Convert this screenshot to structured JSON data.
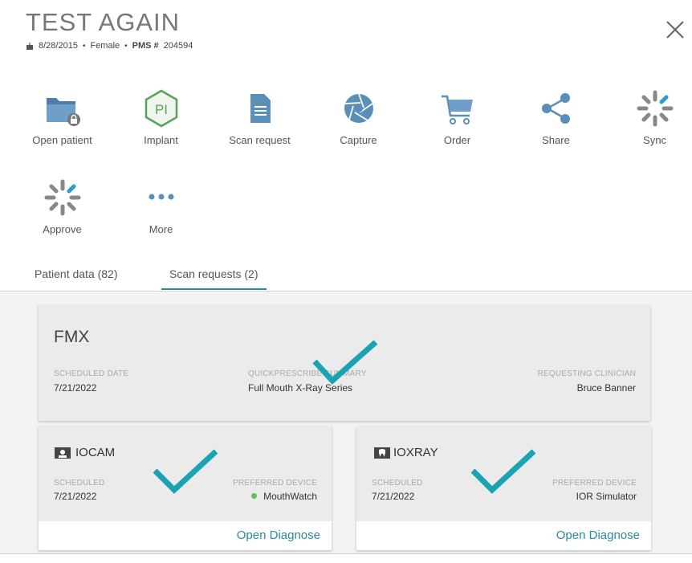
{
  "patient": {
    "name": "TEST AGAIN",
    "dob": "8/28/2015",
    "sex": "Female",
    "pms_label": "PMS #",
    "pms_number": "204594"
  },
  "actions": [
    {
      "label": "Open patient",
      "icon": "folder-lock-icon"
    },
    {
      "label": "Implant",
      "icon": "implant-icon"
    },
    {
      "label": "Scan request",
      "icon": "document-icon"
    },
    {
      "label": "Capture",
      "icon": "aperture-icon"
    },
    {
      "label": "Order",
      "icon": "cart-icon"
    },
    {
      "label": "Share",
      "icon": "share-icon"
    },
    {
      "label": "Sync",
      "icon": "spinner-icon"
    },
    {
      "label": "Approve",
      "icon": "spinner-icon"
    },
    {
      "label": "More",
      "icon": "more-dots-icon"
    }
  ],
  "tabs": [
    {
      "label": "Patient data (82)",
      "active": false
    },
    {
      "label": "Scan requests (2)",
      "active": true
    }
  ],
  "scan_request": {
    "title": "FMX",
    "scheduled_date_label": "SCHEDULED DATE",
    "scheduled_date": "7/21/2022",
    "quickprescribe_label": "QUICKPRESCRIBE SUMMARY",
    "quickprescribe_value": "Full Mouth X-Ray Series",
    "clinician_label": "REQUESTING CLINICIAN",
    "clinician_value": "Bruce Banner"
  },
  "devices": [
    {
      "title": "IOCAM",
      "scheduled_label": "SCHEDULED",
      "scheduled_value": "7/21/2022",
      "preferred_label": "PREFERRED DEVICE",
      "preferred_value": "MouthWatch",
      "open_label": "Open Diagnose"
    },
    {
      "title": "IOXRAY",
      "scheduled_label": "SCHEDULED",
      "scheduled_value": "7/21/2022",
      "preferred_label": "PREFERRED DEVICE",
      "preferred_value": "IOR Simulator",
      "open_label": "Open Diagnose"
    }
  ],
  "colors": {
    "accent": "#2b8a9c",
    "check": "#1aa3b3",
    "icon_blue": "#5a8fb8",
    "implant_green": "#5aa35a",
    "status_green": "#5cc45c"
  }
}
